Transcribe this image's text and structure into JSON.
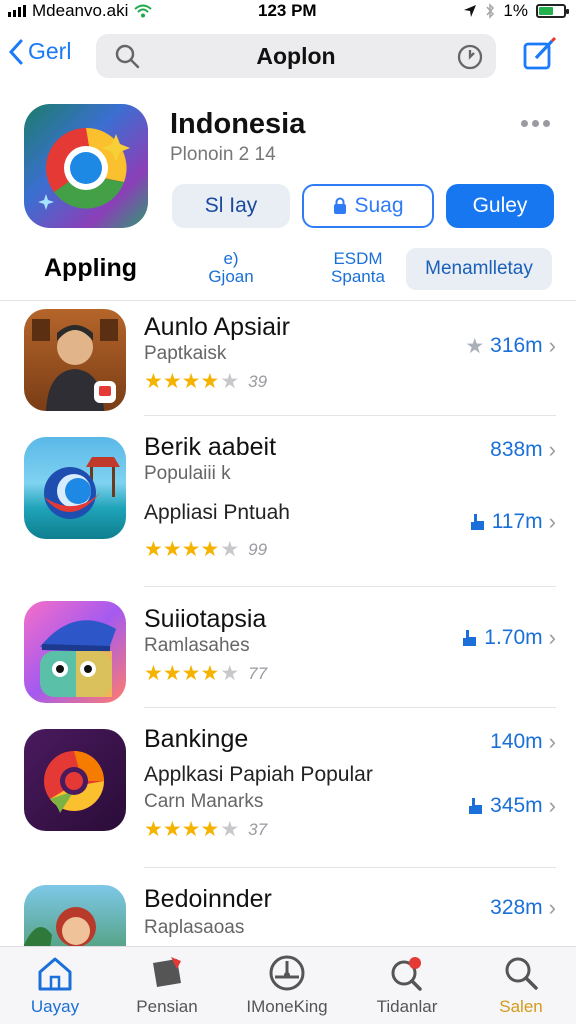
{
  "status_bar": {
    "carrier": "Mdeanvo.aki",
    "time": "123 PM",
    "battery": "1%",
    "battery_level": 0.55
  },
  "nav": {
    "back_label": "Gerl",
    "search_title": "Aoplon"
  },
  "app": {
    "name": "Indonesia",
    "subtitle": "Plonoin 2 14",
    "buttons": [
      "Sl Iay",
      "Suag",
      "Guley"
    ]
  },
  "categories": {
    "title": "Appling",
    "items": [
      {
        "code": "e)",
        "label": "Gjoan"
      },
      {
        "code": "ESDM",
        "label": "Spanta"
      },
      {
        "label": "Menamlletay"
      }
    ]
  },
  "apps": [
    {
      "name": "Aunlo Apsiair",
      "line1": "Paptkaisk",
      "rating": 4,
      "count": "39",
      "meta": "316m"
    },
    {
      "name": "Berik aabeit",
      "line1": "Populaiii k",
      "line2": "Appliasi Pntuah",
      "rating": 4,
      "count": "99",
      "meta_top": "838m",
      "meta": "117m"
    },
    {
      "name": "Suiiotapsia",
      "line1": "Ramlasahes",
      "rating": 4,
      "count": "77",
      "meta": "1.70m"
    },
    {
      "name": "Bankinge",
      "line1": "Applkasi Papiah Popular",
      "line2": "Carn Manarks",
      "rating": 4,
      "count": "37",
      "meta_top": "140m",
      "meta": "345m"
    },
    {
      "name": "Bedoinnder",
      "line1": "Raplasaoas",
      "meta_top": "328m"
    }
  ],
  "tabs": [
    {
      "label": "Uayay",
      "icon": "home-icon"
    },
    {
      "label": "Pensian",
      "icon": "games-icon"
    },
    {
      "label": "IMoneKing",
      "icon": "arcade-icon"
    },
    {
      "label": "Tidanlar",
      "icon": "updates-icon"
    },
    {
      "label": "Salen",
      "icon": "search-icon"
    }
  ],
  "colors": {
    "accent": "#1a6fd8",
    "star": "#f5b300",
    "primary_button": "#1677f0"
  }
}
